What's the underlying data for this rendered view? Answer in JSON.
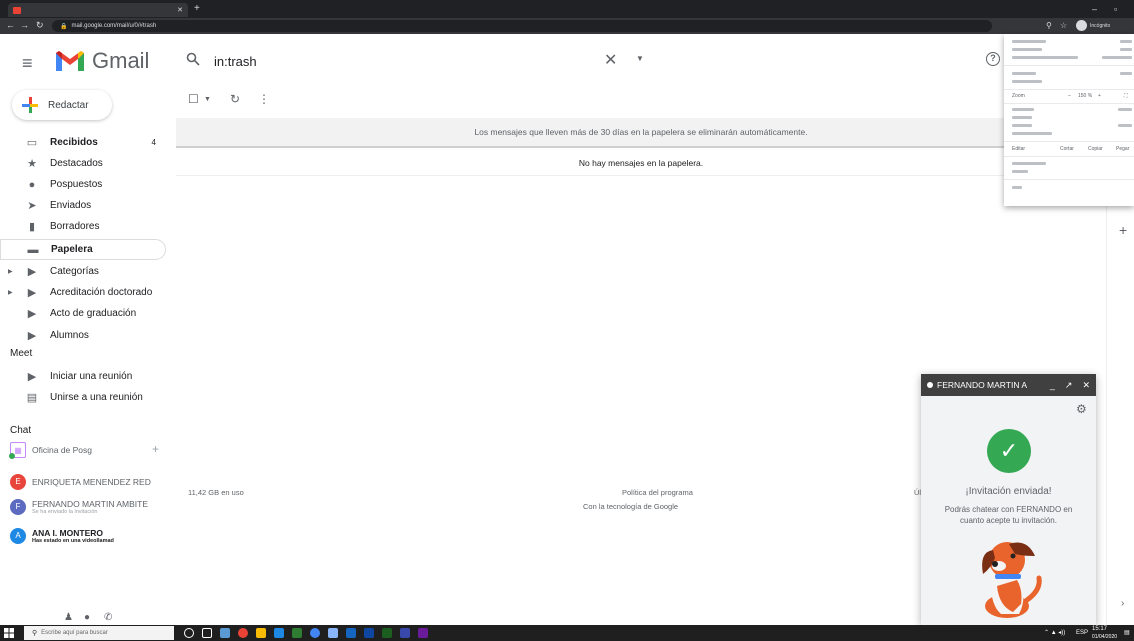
{
  "browser": {
    "tab_title": "",
    "url": "mail.google.com/mail/u/0/#trash",
    "profile_label": "Incógnito"
  },
  "app": {
    "name": "Gmail"
  },
  "search": {
    "value": "in:trash"
  },
  "compose": {
    "label": "Redactar"
  },
  "sidebar": {
    "items": [
      {
        "label": "Recibidos",
        "count": "4",
        "icon": "inbox-icon"
      },
      {
        "label": "Destacados",
        "count": "",
        "icon": "star-icon"
      },
      {
        "label": "Pospuestos",
        "count": "",
        "icon": "clock-icon"
      },
      {
        "label": "Enviados",
        "count": "",
        "icon": "send-icon"
      },
      {
        "label": "Borradores",
        "count": "",
        "icon": "draft-icon"
      },
      {
        "label": "Papelera",
        "count": "",
        "icon": "trash-icon"
      },
      {
        "label": "Categorías",
        "count": "",
        "icon": "label-icon"
      },
      {
        "label": "Acreditación doctorado",
        "count": "",
        "icon": "label-icon"
      },
      {
        "label": "Acto de graduación",
        "count": "",
        "icon": "label-icon"
      },
      {
        "label": "Alumnos",
        "count": "",
        "icon": "label-icon"
      }
    ],
    "meet_heading": "Meet",
    "meet_items": [
      {
        "label": "Iniciar una reunión",
        "icon": "video-icon"
      },
      {
        "label": "Unirse a una reunión",
        "icon": "keyboard-icon"
      }
    ],
    "chat_heading": "Chat",
    "chat_items": [
      {
        "name": "Oficina de Posg",
        "sub": "",
        "initial": ""
      },
      {
        "name": "ENRIQUETA MENENDEZ RED",
        "sub": "",
        "initial": "E"
      },
      {
        "name": "FERNANDO MARTIN AMBITE",
        "sub": "Se ha enviado la invitación",
        "initial": "F"
      },
      {
        "name": "ANA I. MONTERO",
        "sub": "Has estado en una videollamad",
        "initial": "A"
      }
    ]
  },
  "main": {
    "notice": "Los mensajes que lleven más de 30 días en la papelera se eliminarán automáticamente.",
    "empty_message": "No hay mensajes en la papelera.",
    "storage": "11,42 GB en uso",
    "policy": "Política del programa",
    "powered": "Con la tecnología de Google",
    "last_activity": "Úl"
  },
  "chat_window": {
    "name": "FERNANDO MARTIN A",
    "title": "¡Invitación enviada!",
    "description": "Podrás chatear con FERNANDO en cuanto acepte tu invitación."
  },
  "chrome_menu": {
    "zoom_label": "Zoom",
    "zoom_value": "150 %",
    "edit_label": "Editar",
    "cut_label": "Cortar",
    "copy_label": "Copiar",
    "paste_label": "Pegar"
  },
  "taskbar": {
    "search_placeholder": "Escribe aquí para buscar",
    "time": "15:17",
    "date": "01/04/2020",
    "lang": "ESP"
  },
  "colors": {
    "gmail_red": "#ea4335",
    "gmail_blue": "#4285f4",
    "gmail_green": "#34a853",
    "gmail_yellow": "#fbbc04"
  }
}
